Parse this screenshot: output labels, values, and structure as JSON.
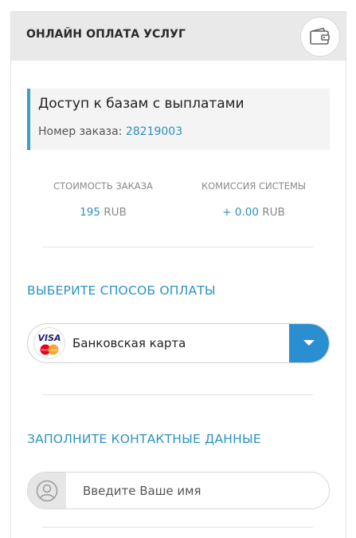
{
  "header": {
    "title": "ОНЛАЙН ОПЛАТА УСЛУГ",
    "icon": "wallet-icon"
  },
  "order": {
    "title": "Доступ к базам с выплатами",
    "number_label": "Номер заказа:",
    "number": "28219003"
  },
  "summary": {
    "cost_label": "СТОИМОСТЬ ЗАКАЗА",
    "cost_amount": "195",
    "cost_currency": "RUB",
    "fee_label": "КОМИССИЯ СИСТЕМЫ",
    "fee_amount": "+ 0.00",
    "fee_currency": "RUB"
  },
  "payment": {
    "section_title": "ВЫБЕРИТЕ СПОСОБ ОПЛАТЫ",
    "selected_method": "Банковская карта",
    "logo_text_top": "VISA",
    "logo_text_bottom": "MasterCard",
    "dropdown_icon": "chevron-down-icon"
  },
  "contact": {
    "section_title": "ЗАПОЛНИТЕ КОНТАКТНЫЕ ДАННЫЕ",
    "name_placeholder": "Введите Ваше имя",
    "name_value": "",
    "name_icon": "user-icon"
  },
  "colors": {
    "accent": "#2e93c2",
    "header_bg": "#e9e9e9",
    "dropdown_bg": "#2a8fd0"
  }
}
